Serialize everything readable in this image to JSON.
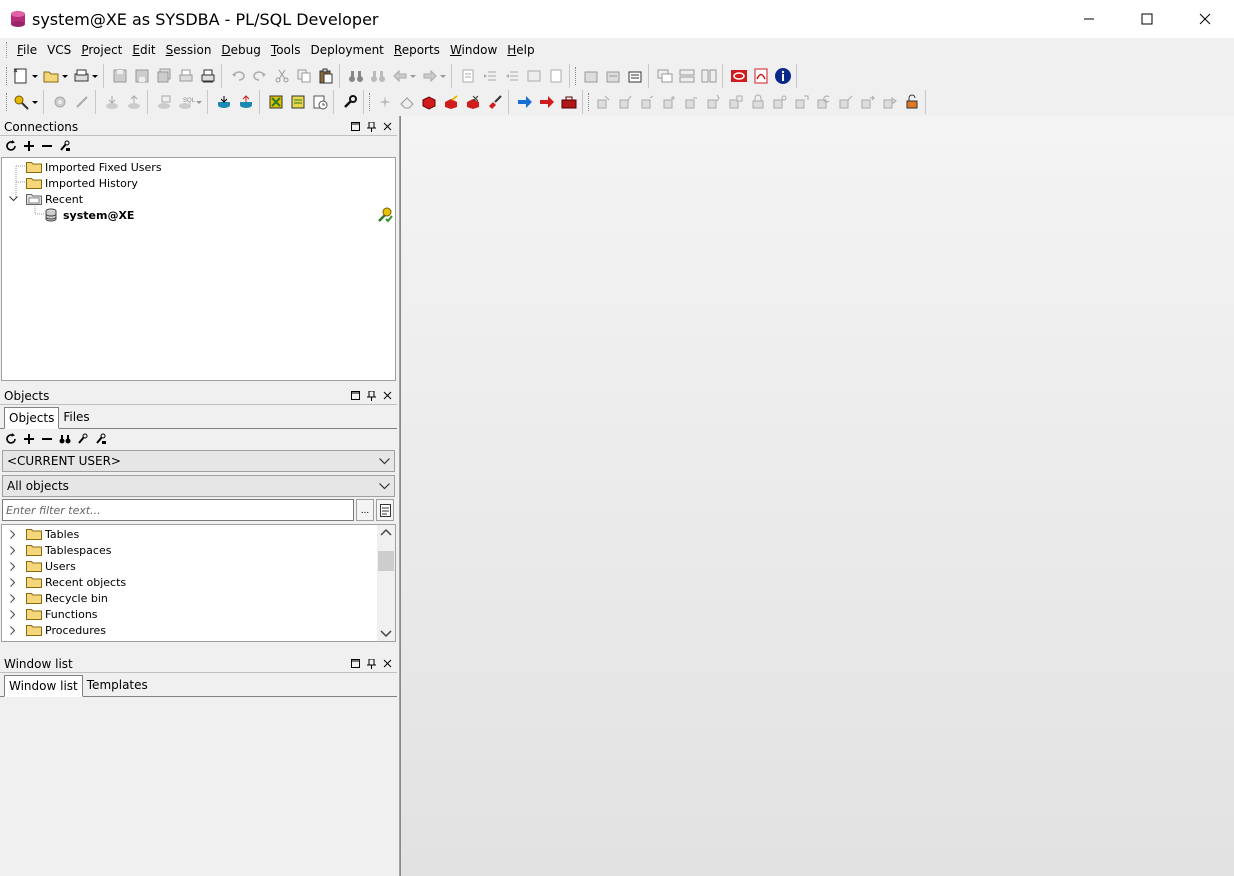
{
  "window": {
    "title": "system@XE as SYSDBA - PL/SQL Developer",
    "minimize_glyph": "─",
    "maximize_glyph": "☐",
    "close_glyph": "✕"
  },
  "menu": [
    {
      "label": "File",
      "underline": "F",
      "rest": "ile"
    },
    {
      "label": "VCS",
      "underline": "",
      "rest": "VCS"
    },
    {
      "label": "Project",
      "underline": "P",
      "rest": "roject"
    },
    {
      "label": "Edit",
      "underline": "E",
      "rest": "dit"
    },
    {
      "label": "Session",
      "underline": "S",
      "rest": "ession"
    },
    {
      "label": "Debug",
      "underline": "D",
      "rest": "ebug"
    },
    {
      "label": "Tools",
      "underline": "T",
      "rest": "ools"
    },
    {
      "label": "Deployment",
      "underline": "",
      "rest": "Deployment"
    },
    {
      "label": "Reports",
      "underline": "R",
      "rest": "eports"
    },
    {
      "label": "Window",
      "underline": "W",
      "rest": "indow"
    },
    {
      "label": "Help",
      "underline": "H",
      "rest": "elp"
    }
  ],
  "connections": {
    "title": "Connections",
    "tree": [
      {
        "label": "Imported Fixed Users",
        "icon": "folder-icon"
      },
      {
        "label": "Imported History",
        "icon": "folder-icon"
      },
      {
        "label": "Recent",
        "icon": "folder-open-icon",
        "expanded": true
      },
      {
        "label": "system@XE",
        "icon": "database-icon"
      }
    ]
  },
  "objects": {
    "title": "Objects",
    "tabs": [
      "Objects",
      "Files"
    ],
    "user_combo": "<CURRENT USER>",
    "filter_combo": "All objects",
    "filter_placeholder": "Enter filter text...",
    "filter_button": "...",
    "tree": [
      "Tables",
      "Tablespaces",
      "Users",
      "Recent objects",
      "Recycle bin",
      "Functions",
      "Procedures"
    ],
    "scroll_position": 0.15
  },
  "window_list": {
    "title": "Window list",
    "tabs": [
      "Window list",
      "Templates"
    ]
  },
  "colors": {
    "accent_red": "#d01c1c",
    "accent_blue": "#1a6fd6",
    "folder_yellow": "#f3d77a",
    "info_blue": "#0a2a8a"
  }
}
